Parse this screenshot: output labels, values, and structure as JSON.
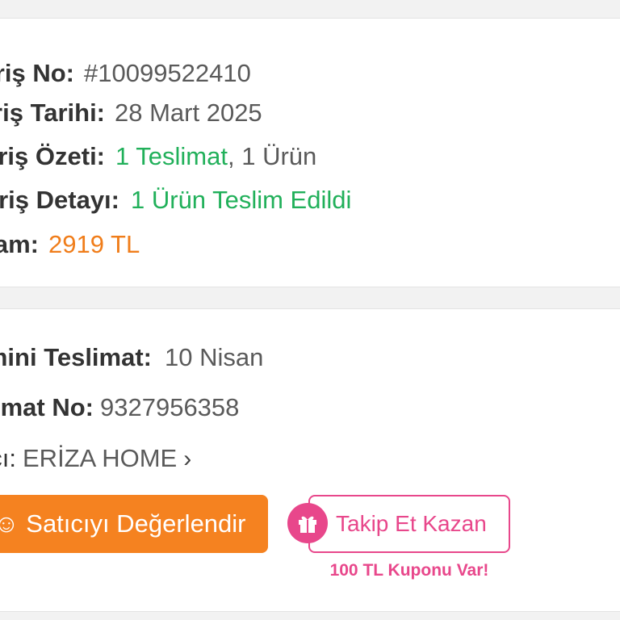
{
  "order": {
    "order_no_label": "Sipariş No:",
    "order_no_value": "#10099522410",
    "order_date_label": "Sipariş Tarihi:",
    "order_date_value": "28 Mart 2025",
    "summary_label": "Sipariş Özeti:",
    "summary_delivery": "1 Teslimat",
    "summary_sep": ", ",
    "summary_items": "1 Ürün",
    "detail_label": "Sipariş Detayı:",
    "detail_value": "1 Ürün Teslim Edildi",
    "total_label": "Toplam:",
    "total_value": "2919 TL"
  },
  "delivery": {
    "estimated_label": "Tahmini Teslimat:",
    "estimated_value": "10 Nisan",
    "delivery_no_label": "Teslimat No:",
    "delivery_no_value": "9327956358",
    "seller_label": "Satıcı:",
    "seller_value": "ERİZA HOME",
    "seller_chevron": "›",
    "rate_button_label": "☺ Satıcıyı Değerlendir",
    "follow_button_label": "Takip Et Kazan",
    "coupon_note": "100 TL Kuponu Var!"
  },
  "colors": {
    "green": "#21b05a",
    "orange": "#f07d1a",
    "pink": "#e8478b",
    "button_orange": "#f58220"
  },
  "icons": {
    "gift": "gift-icon",
    "chevron": "chevron-right-icon"
  }
}
